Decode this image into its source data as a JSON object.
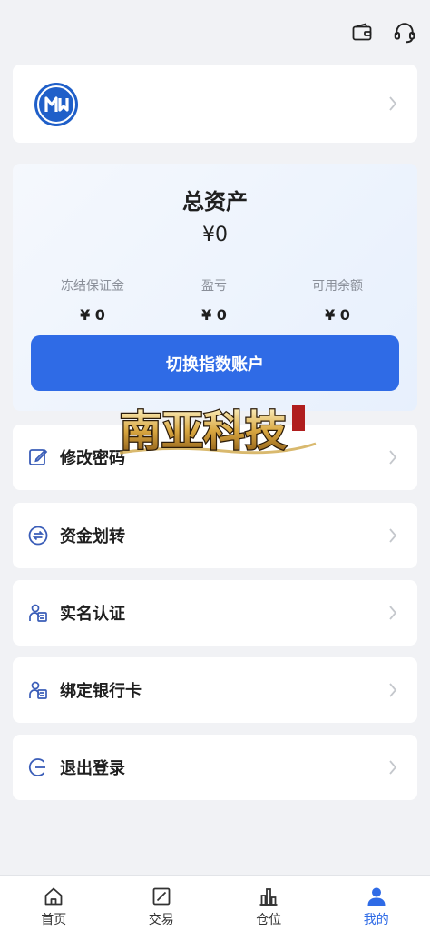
{
  "header": {
    "icons": [
      "wallet-icon",
      "headset-icon"
    ]
  },
  "profile": {
    "logo_icon": "brand-logo"
  },
  "assets": {
    "title": "总资产",
    "total": "¥0",
    "stats": [
      {
        "label": "冻结保证金",
        "value": "¥ 0"
      },
      {
        "label": "盈亏",
        "value": "¥ 0"
      },
      {
        "label": "可用余额",
        "value": "¥ 0"
      }
    ],
    "switch_button": "切换指数账户"
  },
  "watermark": {
    "text": "南亚科技"
  },
  "menu": [
    {
      "label": "修改密码",
      "icon": "edit-icon"
    },
    {
      "label": "资金划转",
      "icon": "transfer-icon"
    },
    {
      "label": "实名认证",
      "icon": "id-card-icon"
    },
    {
      "label": "绑定银行卡",
      "icon": "id-card-icon"
    },
    {
      "label": "退出登录",
      "icon": "logout-icon"
    }
  ],
  "tabbar": {
    "items": [
      {
        "label": "首页",
        "icon": "home-icon"
      },
      {
        "label": "交易",
        "icon": "trade-icon"
      },
      {
        "label": "仓位",
        "icon": "chart-icon"
      },
      {
        "label": "我的",
        "icon": "user-icon"
      }
    ],
    "active_color": "#2f6be6"
  },
  "colors": {
    "accent": "#2f6be6",
    "background": "#f1f2f5"
  }
}
